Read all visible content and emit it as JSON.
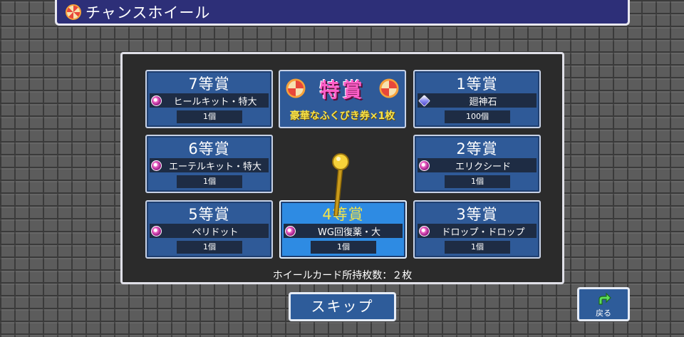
{
  "title": "チャンスホイール",
  "special_prize": {
    "label": "特賞",
    "subtitle": "豪華なふくびき券×1枚"
  },
  "prizes": [
    {
      "rank": "7等賞",
      "item": "ヒールキット・特大",
      "count": "1個",
      "icon": "potion-icon"
    },
    {
      "rank": "1等賞",
      "item": "廻神石",
      "count": "100個",
      "icon": "gem-icon"
    },
    {
      "rank": "6等賞",
      "item": "エーテルキット・特大",
      "count": "1個",
      "icon": "potion-icon"
    },
    {
      "rank": "2等賞",
      "item": "エリクシード",
      "count": "1個",
      "icon": "potion-icon"
    },
    {
      "rank": "5等賞",
      "item": "ペリドット",
      "count": "1個",
      "icon": "potion-icon"
    },
    {
      "rank": "4等賞",
      "item": "WG回復薬・大",
      "count": "1個",
      "icon": "potion-icon",
      "selected": true
    },
    {
      "rank": "3等賞",
      "item": "ドロップ・ドロップ",
      "count": "1個",
      "icon": "potion-icon"
    }
  ],
  "footer": "ホイールカード所持枚数：２枚",
  "skip_label": "スキップ",
  "back_label": "戻る",
  "colors": {
    "panel_blue": "#2f5a98",
    "active_blue": "#2e8be3",
    "special_pink": "#ff5ec8",
    "gold": "#f6e24a"
  }
}
